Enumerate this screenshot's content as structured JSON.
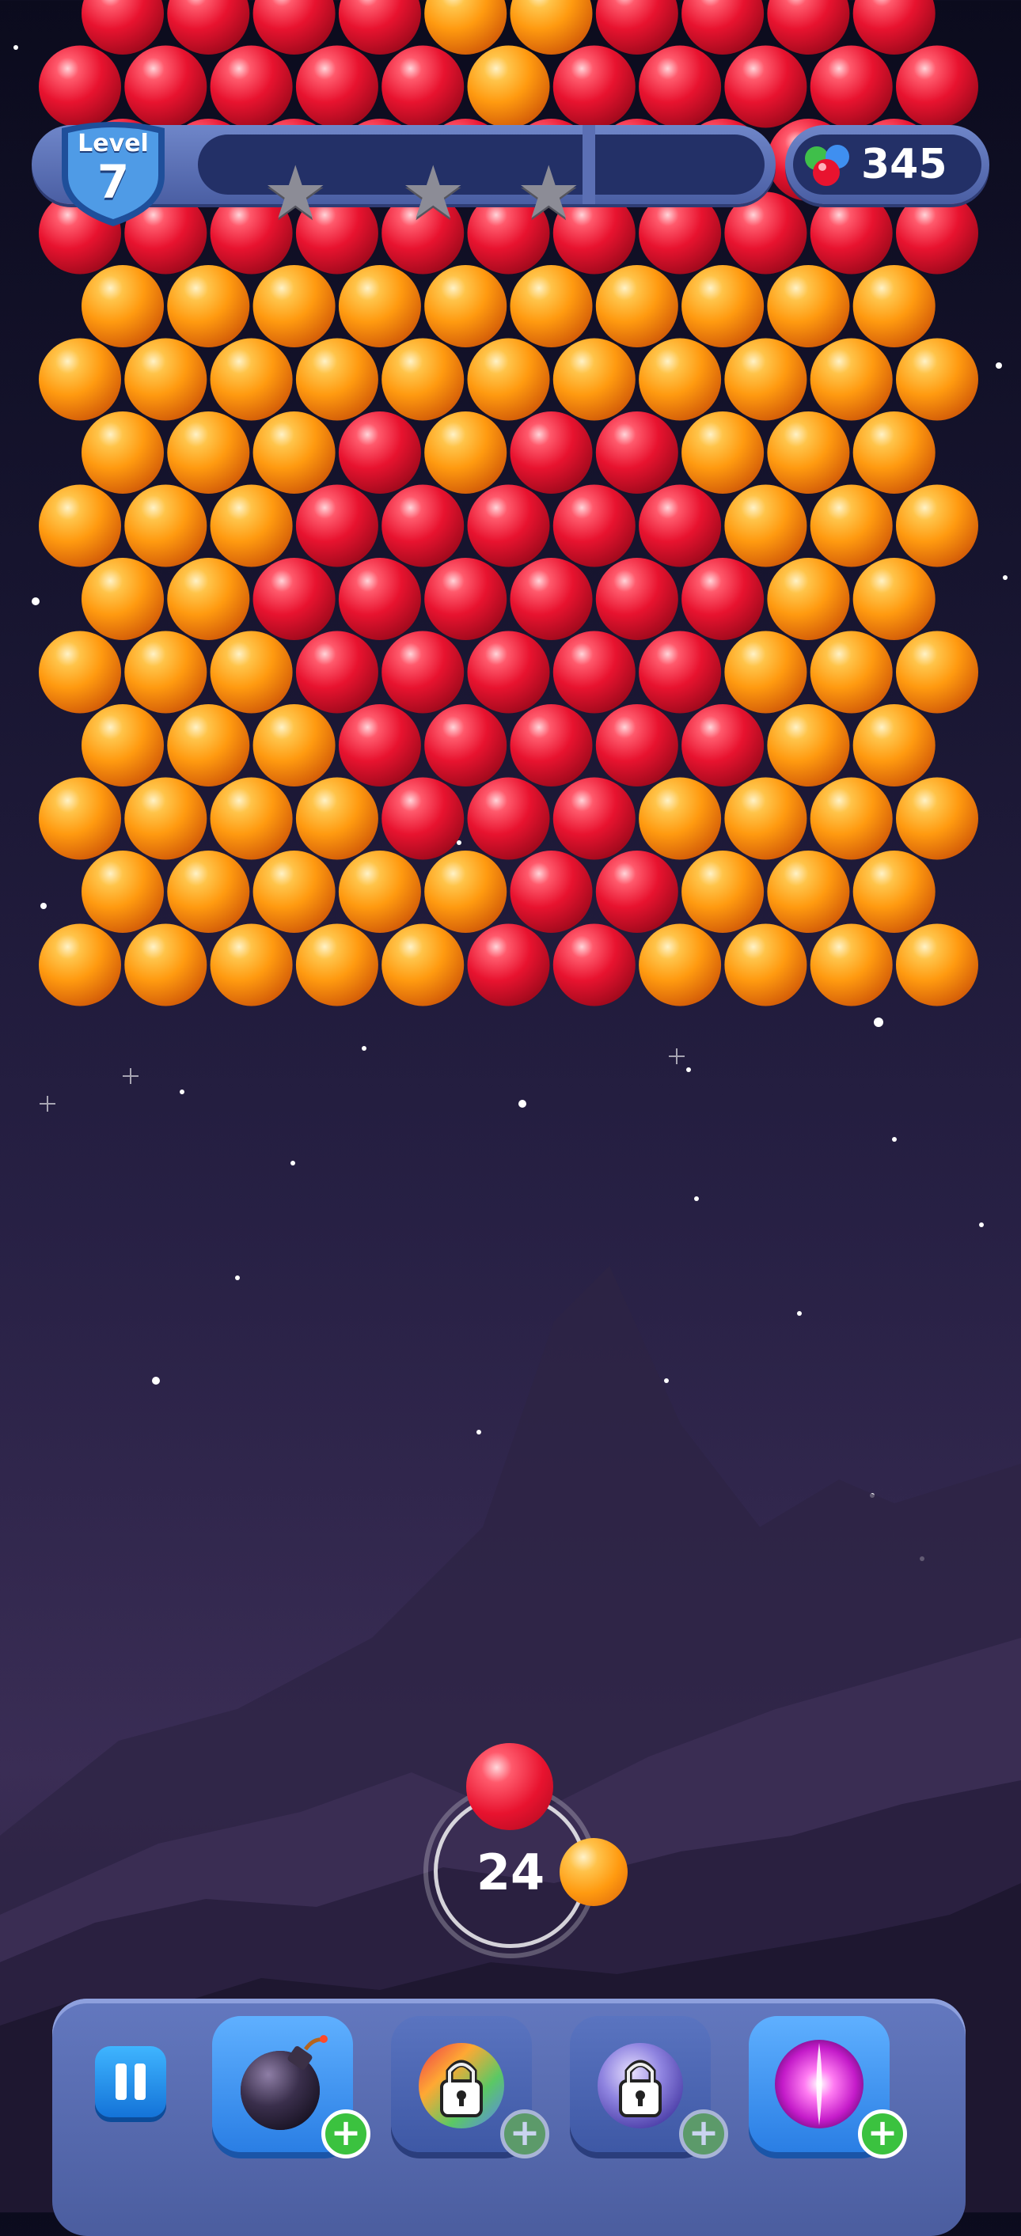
{
  "hud": {
    "level_title": "Level",
    "level_number": "7",
    "stars_earned": 0,
    "stars_total": 3,
    "bubble_count": "345"
  },
  "shooter": {
    "shots_left": "24",
    "current_ball": "red",
    "next_ball": "orange"
  },
  "boosters": [
    {
      "name": "bomb",
      "locked": false
    },
    {
      "name": "rainbow-ball",
      "locked": true
    },
    {
      "name": "lightning-ball",
      "locked": true
    },
    {
      "name": "fireball",
      "locked": false
    }
  ],
  "colors": {
    "red": "#e8132f",
    "orange": "#ff9a10",
    "hud_blue": "#4a5ea3"
  },
  "board": {
    "rows": [
      "RRRROORRRR",
      "RRRRRORRRRR",
      "RRRRRRRRRR",
      "RRRRRRRRRRR",
      "OOOOOOOOOO",
      "OOOOOOOOOOO",
      "OOORORROOO",
      "OOORRRRROOO",
      "OORRRRRROO",
      "OOORRRRROOO",
      "OOORRRRROO",
      "OOOORRROOOO",
      "OOOOORROOO",
      "OOOOORROOOO"
    ]
  }
}
